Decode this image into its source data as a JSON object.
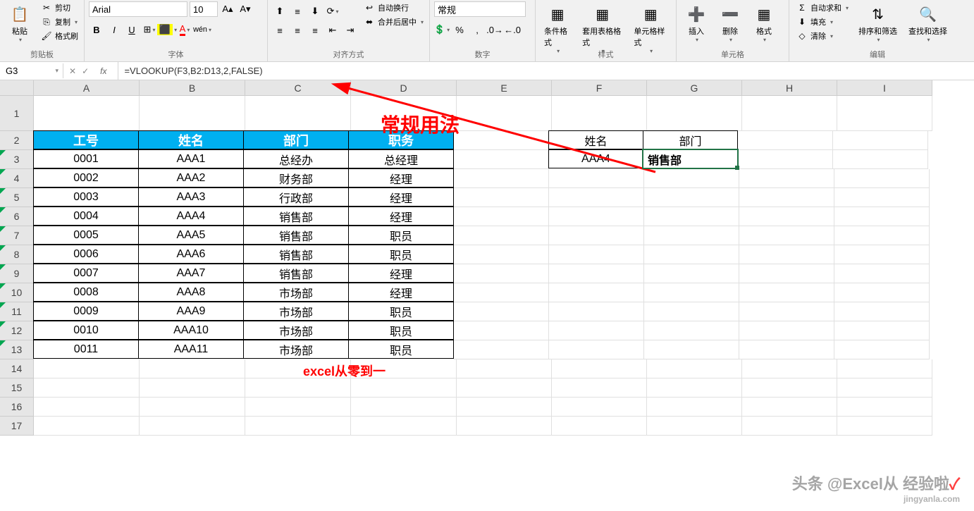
{
  "ribbon": {
    "clipboard": {
      "paste": "粘贴",
      "cut": "剪切",
      "copy": "复制",
      "format_painter": "格式刷",
      "label": "剪贴板"
    },
    "font": {
      "name": "Arial",
      "size": "10",
      "bold": "B",
      "italic": "I",
      "underline": "U",
      "label": "字体"
    },
    "alignment": {
      "wrap": "自动换行",
      "merge": "合并后居中",
      "label": "对齐方式"
    },
    "number": {
      "format": "常规",
      "label": "数字"
    },
    "styles": {
      "conditional": "条件格式",
      "table": "套用表格格式",
      "cell": "单元格样式",
      "label": "样式"
    },
    "cells": {
      "insert": "插入",
      "delete": "删除",
      "format": "格式",
      "label": "单元格"
    },
    "editing": {
      "autosum": "自动求和",
      "fill": "填充",
      "clear": "清除",
      "sort": "排序和筛选",
      "find": "查找和选择",
      "label": "编辑"
    }
  },
  "formula_bar": {
    "name_box": "G3",
    "fx": "fx",
    "formula": "=VLOOKUP(F3,B2:D13,2,FALSE)"
  },
  "columns": [
    "A",
    "B",
    "C",
    "D",
    "E",
    "F",
    "G",
    "H",
    "I"
  ],
  "rows": [
    "1",
    "2",
    "3",
    "4",
    "5",
    "6",
    "7",
    "8",
    "9",
    "10",
    "11",
    "12",
    "13",
    "14",
    "15",
    "16",
    "17"
  ],
  "table": {
    "headers": [
      "工号",
      "姓名",
      "部门",
      "职务"
    ],
    "data": [
      [
        "0001",
        "AAA1",
        "总经办",
        "总经理"
      ],
      [
        "0002",
        "AAA2",
        "财务部",
        "经理"
      ],
      [
        "0003",
        "AAA3",
        "行政部",
        "经理"
      ],
      [
        "0004",
        "AAA4",
        "销售部",
        "经理"
      ],
      [
        "0005",
        "AAA5",
        "销售部",
        "职员"
      ],
      [
        "0006",
        "AAA6",
        "销售部",
        "职员"
      ],
      [
        "0007",
        "AAA7",
        "销售部",
        "经理"
      ],
      [
        "0008",
        "AAA8",
        "市场部",
        "经理"
      ],
      [
        "0009",
        "AAA9",
        "市场部",
        "职员"
      ],
      [
        "0010",
        "AAA10",
        "市场部",
        "职员"
      ],
      [
        "0011",
        "AAA11",
        "市场部",
        "职员"
      ]
    ]
  },
  "lookup": {
    "h1": "姓名",
    "h2": "部门",
    "v1": "AAA4",
    "v2": "销售部"
  },
  "annotations": {
    "title": "常规用法",
    "footer": "excel从零到一"
  },
  "watermark": {
    "main": "头条 @Excel从 经验啦",
    "sub": "jingyanla.com"
  }
}
